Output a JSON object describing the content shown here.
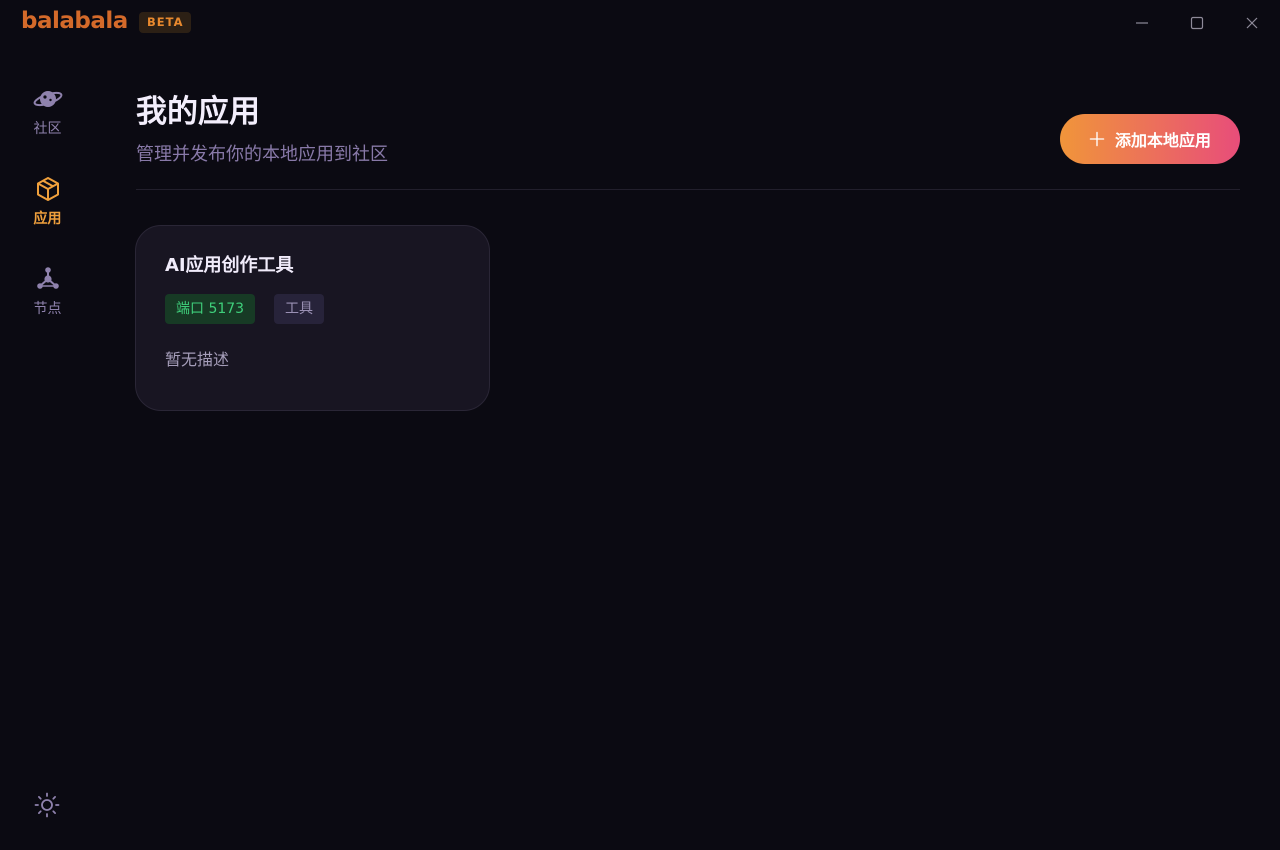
{
  "app": {
    "logo_text": "balabala",
    "badge": "BETA"
  },
  "window_controls": {
    "minimize_icon": "minimize-icon",
    "maximize_icon": "maximize-icon",
    "close_icon": "close-icon"
  },
  "sidebar": {
    "items": [
      {
        "label": "社区",
        "icon": "planet-icon",
        "active": false
      },
      {
        "label": "应用",
        "icon": "cube-icon",
        "active": true
      },
      {
        "label": "节点",
        "icon": "nodes-icon",
        "active": false
      }
    ],
    "theme_icon": "sun-icon"
  },
  "main": {
    "title": "我的应用",
    "subtitle": "管理并发布你的本地应用到社区",
    "add_button_label": "添加本地应用",
    "apps": [
      {
        "name": "AI应用创作工具",
        "port_tag": "端口 5173",
        "type_tag": "工具",
        "description": "暂无描述"
      }
    ]
  },
  "colors": {
    "background": "#0b0a12",
    "accent_orange": "#f0a03c",
    "gradient_start": "#f0953a",
    "gradient_end": "#e84d7a",
    "port_tag_text": "#3fcf7b",
    "muted_text": "#8879a8",
    "card_bg": "#181522"
  }
}
